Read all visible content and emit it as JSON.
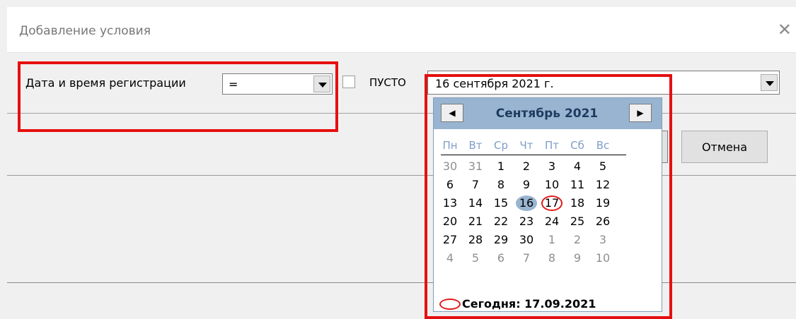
{
  "dialog": {
    "title": "Добавление условия",
    "close_icon": "close-icon"
  },
  "condition": {
    "field_label": "Дата и время регистрации",
    "operator_value": "=",
    "empty_label": "ПУСТО",
    "date_value": "16 сентября 2021 г."
  },
  "buttons": {
    "cancel_label": "Отмена"
  },
  "calendar": {
    "month_label": "Сентябрь 2021",
    "prev_icon": "triangle-left-icon",
    "next_icon": "triangle-right-icon",
    "weekdays": [
      "Пн",
      "Вт",
      "Ср",
      "Чт",
      "Пт",
      "Сб",
      "Вс"
    ],
    "weeks": [
      [
        {
          "d": "30",
          "o": true
        },
        {
          "d": "31",
          "o": true
        },
        {
          "d": "1"
        },
        {
          "d": "2"
        },
        {
          "d": "3"
        },
        {
          "d": "4"
        },
        {
          "d": "5"
        }
      ],
      [
        {
          "d": "6"
        },
        {
          "d": "7"
        },
        {
          "d": "8"
        },
        {
          "d": "9"
        },
        {
          "d": "10"
        },
        {
          "d": "11"
        },
        {
          "d": "12"
        }
      ],
      [
        {
          "d": "13"
        },
        {
          "d": "14"
        },
        {
          "d": "15"
        },
        {
          "d": "16",
          "sel": true
        },
        {
          "d": "17",
          "today": true
        },
        {
          "d": "18"
        },
        {
          "d": "19"
        }
      ],
      [
        {
          "d": "20"
        },
        {
          "d": "21"
        },
        {
          "d": "22"
        },
        {
          "d": "23"
        },
        {
          "d": "24"
        },
        {
          "d": "25"
        },
        {
          "d": "26"
        }
      ],
      [
        {
          "d": "27"
        },
        {
          "d": "28"
        },
        {
          "d": "29"
        },
        {
          "d": "30"
        },
        {
          "d": "1",
          "o": true
        },
        {
          "d": "2",
          "o": true
        },
        {
          "d": "3",
          "o": true
        }
      ],
      [
        {
          "d": "4",
          "o": true
        },
        {
          "d": "5",
          "o": true
        },
        {
          "d": "6",
          "o": true
        },
        {
          "d": "7",
          "o": true
        },
        {
          "d": "8",
          "o": true
        },
        {
          "d": "9",
          "o": true
        },
        {
          "d": "10",
          "o": true
        }
      ]
    ],
    "today_label": "Сегодня: 17.09.2021"
  },
  "colors": {
    "highlight": "#e60f0f",
    "calendar_header": "#99b4d1",
    "weekday_text": "#7f9ec7",
    "other_month_text": "#8f8f8f"
  }
}
